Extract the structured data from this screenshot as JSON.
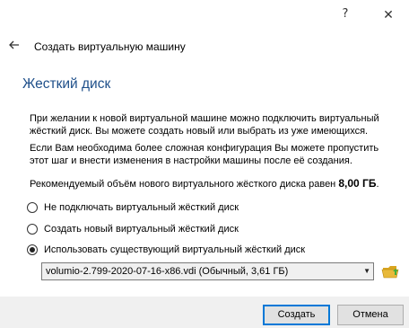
{
  "window": {
    "help_glyph": "?",
    "close_glyph": "✕"
  },
  "wizard": {
    "title": "Создать виртуальную машину",
    "page_heading": "Жесткий диск"
  },
  "description": {
    "line1": "При желании к новой виртуальной машине можно подключить виртуальный жёсткий диск. Вы можете создать новый или выбрать из уже имеющихся.",
    "line2": "Если Вам необходима более сложная конфигурация Вы можете пропустить этот шаг и внести изменения в настройки машины после её создания.",
    "recommend_text": "Рекомендуемый объём нового виртуального жёсткого диска равен ",
    "recommend_size": "8,00 ГБ",
    "recommend_end": "."
  },
  "options": [
    {
      "label": "Не подключать виртуальный жёсткий диск",
      "selected": false
    },
    {
      "label": "Создать новый виртуальный жёсткий диск",
      "selected": false
    },
    {
      "label": "Использовать существующий виртуальный жёсткий диск",
      "selected": true
    }
  ],
  "disk_select": {
    "value": "volumio-2.799-2020-07-16-x86.vdi (Обычный, 3,61 ГБ)"
  },
  "buttons": {
    "create": "Создать",
    "cancel": "Отмена"
  },
  "colors": {
    "heading": "#1e4f8a",
    "default_button_border": "#0078d7",
    "folder_icon": "#e8b93a",
    "folder_icon_accent": "#3fae3f"
  },
  "icons": {
    "back": "arrow-left-icon",
    "folder": "folder-open-icon",
    "dropdown": "chevron-down-icon"
  }
}
